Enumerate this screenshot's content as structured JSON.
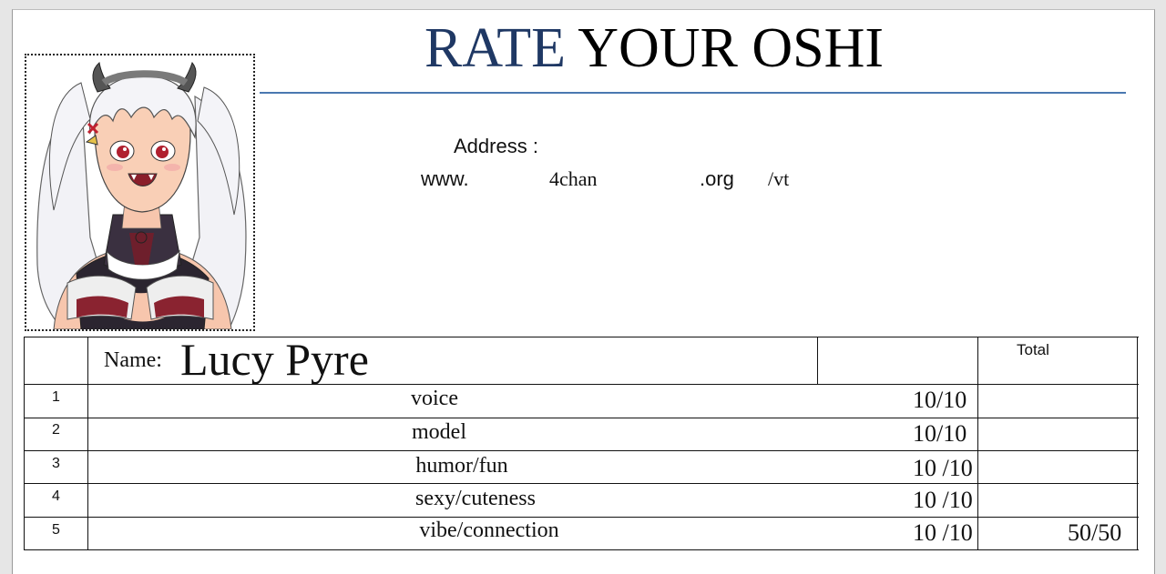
{
  "header": {
    "title_part1": "RATE",
    "title_part2": "YOUR OSHI",
    "address_label": "Address :",
    "address": {
      "www": "www.",
      "domain": "4chan",
      "tld": ".org",
      "board": "/vt"
    }
  },
  "photo": {
    "icon": "anime-character-portrait"
  },
  "table": {
    "name_label": "Name:",
    "name_value": "Lucy Pyre",
    "total_label": "Total",
    "rows": [
      {
        "num": "1",
        "category": "voice",
        "score": "10/10"
      },
      {
        "num": "2",
        "category": "model",
        "score": "10/10"
      },
      {
        "num": "3",
        "category": "humor/fun",
        "score": "10 /10"
      },
      {
        "num": "4",
        "category": "sexy/cuteness",
        "score": "10 /10"
      },
      {
        "num": "5",
        "category": "vibe/connection",
        "score": "10 /10"
      }
    ],
    "total_value": "50/50"
  },
  "colors": {
    "title_accent": "#1f3864",
    "rule": "#4a78b0"
  }
}
